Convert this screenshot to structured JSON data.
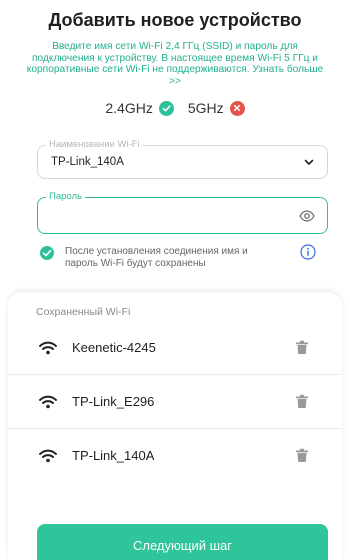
{
  "title": "Добавить новое устройство",
  "description": "Введите имя сети Wi-Fi 2,4 ГГц (SSID) и пароль для подключения к устройству. В настоящее время Wi-Fi 5 ГГц и корпоративные сети Wi-Fi не поддерживаются. Узнать больше >>",
  "bands": [
    {
      "label": "2.4GHz",
      "supported": true,
      "icon": "check-circle-icon",
      "color": "#2dbf98"
    },
    {
      "label": "5GHz",
      "supported": false,
      "icon": "close-circle-icon",
      "color": "#e4544a"
    }
  ],
  "wifi_field": {
    "label": "Наименование Wi-Fi",
    "value": "TP-Link_140A"
  },
  "password_field": {
    "label": "Пароль",
    "value": ""
  },
  "save_note": "После установления соединения имя и пароль Wi-Fi будут сохранены",
  "saved": {
    "title": "Сохраненный Wi-Fi",
    "networks": [
      {
        "ssid": "Keenetic-4245"
      },
      {
        "ssid": "TP-Link_E296"
      },
      {
        "ssid": "TP-Link_140A"
      }
    ]
  },
  "next_button": "Следующий шаг",
  "colors": {
    "accent": "#2dbf98",
    "error": "#e4544a"
  }
}
